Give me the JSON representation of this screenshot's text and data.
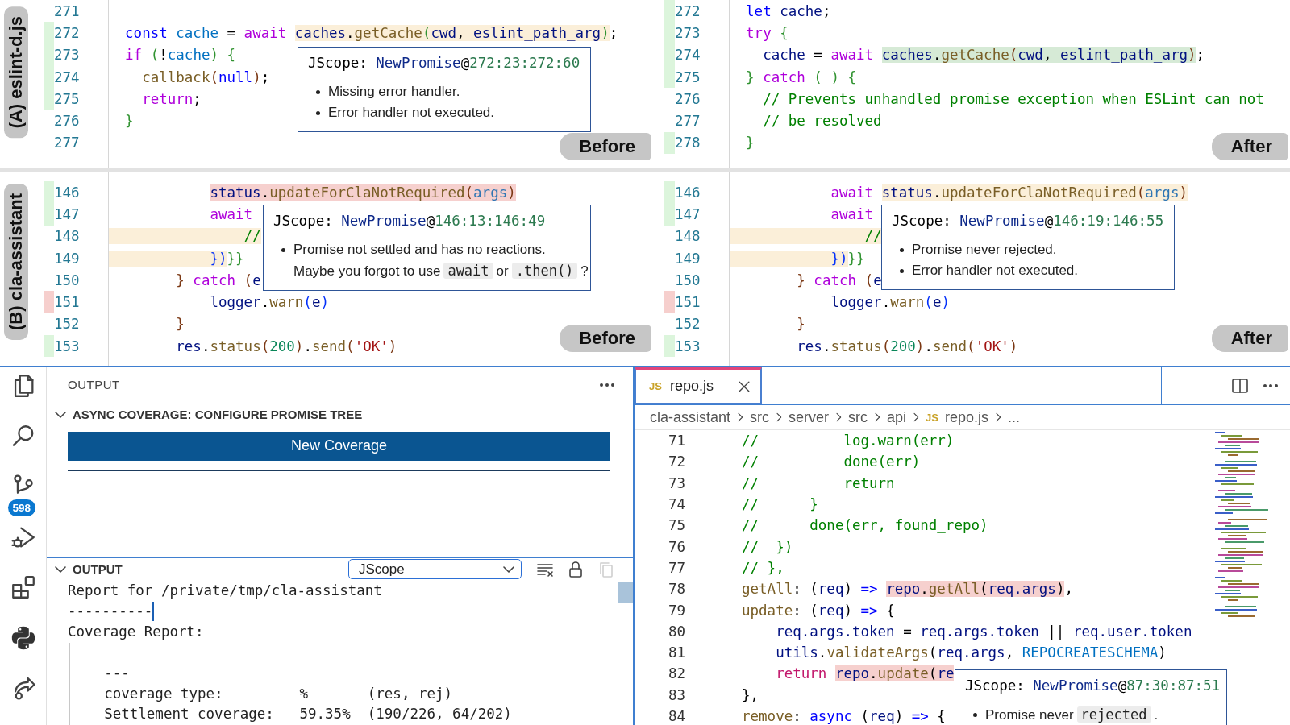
{
  "comparisons": [
    {
      "label": "(A) eslint-d.js",
      "sides": [
        {
          "badge": "Before",
          "lines": [
            {
              "number": "271",
              "added": false,
              "removed": false
            },
            {
              "number": "272",
              "added": true,
              "removed": false,
              "tokens": [
                {
                  "text": "  const ",
                  "kind": "st"
                },
                {
                  "text": "cache",
                  "kind": "c"
                },
                {
                  "text": " = ",
                  "kind": "p"
                },
                {
                  "text": "await ",
                  "kind": "ctl"
                },
                {
                  "text": "caches",
                  "kind": "v",
                  "color": "#fbefd9"
                },
                {
                  "text": ".",
                  "kind": "p",
                  "color": "#fbefd9"
                },
                {
                  "text": "getCache",
                  "kind": "fn",
                  "color": "#fbefd9"
                },
                {
                  "text": "(",
                  "kind": "b2",
                  "color": "#fbefd9"
                },
                {
                  "text": "cwd",
                  "kind": "v",
                  "color": "#fbefd9"
                },
                {
                  "text": ", ",
                  "kind": "p",
                  "color": "#fbefd9"
                },
                {
                  "text": "eslint_path_arg",
                  "kind": "v",
                  "color": "#fbefd9"
                },
                {
                  "text": ")",
                  "kind": "b2",
                  "color": "#fbefd9"
                },
                {
                  "text": ";",
                  "kind": "p"
                }
              ]
            },
            {
              "number": "273",
              "added": true,
              "removed": false,
              "tokens": [
                {
                  "text": "  if ",
                  "kind": "ctl"
                },
                {
                  "text": "(",
                  "kind": "b2"
                },
                {
                  "text": "!",
                  "kind": "p"
                },
                {
                  "text": "cache",
                  "kind": "c"
                },
                {
                  "text": ")",
                  "kind": "b2"
                },
                {
                  "text": " {",
                  "kind": "b2"
                }
              ]
            },
            {
              "number": "274",
              "added": true,
              "removed": false,
              "tokens": [
                {
                  "text": "    callback",
                  "kind": "fn"
                },
                {
                  "text": "(",
                  "kind": "b3"
                },
                {
                  "text": "null",
                  "kind": "st"
                },
                {
                  "text": ")",
                  "kind": "b3"
                },
                {
                  "text": ";",
                  "kind": "p"
                }
              ]
            },
            {
              "number": "275",
              "added": true,
              "removed": false,
              "tokens": [
                {
                  "text": "    return",
                  "kind": "ctl"
                },
                {
                  "text": ";",
                  "kind": "p"
                }
              ]
            },
            {
              "number": "276",
              "added": false,
              "removed": false,
              "tokens": [
                {
                  "text": "  }",
                  "kind": "b2"
                }
              ]
            },
            {
              "number": "277",
              "added": false,
              "removed": false
            }
          ],
          "tooltip": {
            "title": [
              {
                "text": "JScope: ",
                "kind": "p"
              },
              {
                "text": "NewPromise",
                "kind": "type"
              },
              {
                "text": "@",
                "kind": "p"
              },
              {
                "text": "272:23:272:60",
                "kind": "loc"
              }
            ],
            "items": [
              {
                "bulleted": true,
                "segments": [
                  {
                    "text": "Missing error handler.",
                    "kind": "plain"
                  }
                ]
              },
              {
                "bulleted": true,
                "segments": [
                  {
                    "text": "Error handler not executed.",
                    "kind": "plain"
                  }
                ]
              }
            ]
          }
        },
        {
          "badge": "After",
          "lines": [
            {
              "number": "272",
              "added": true,
              "removed": false,
              "tokens": [
                {
                  "text": "  let",
                  "kind": "st"
                },
                {
                  "text": " cache",
                  "kind": "v"
                },
                {
                  "text": ";",
                  "kind": "p"
                }
              ]
            },
            {
              "number": "273",
              "added": true,
              "removed": false,
              "tokens": [
                {
                  "text": "  try",
                  "kind": "ctl"
                },
                {
                  "text": " {",
                  "kind": "b2"
                }
              ]
            },
            {
              "number": "274",
              "added": true,
              "removed": false,
              "tokens": [
                {
                  "text": "    cache",
                  "kind": "v"
                },
                {
                  "text": " = ",
                  "kind": "p"
                },
                {
                  "text": "await ",
                  "kind": "ctl"
                },
                {
                  "text": "caches",
                  "kind": "v",
                  "color": "#d6ead6"
                },
                {
                  "text": ".",
                  "kind": "p",
                  "color": "#d6ead6"
                },
                {
                  "text": "getCache",
                  "kind": "fn",
                  "color": "#d6ead6"
                },
                {
                  "text": "(",
                  "kind": "b3",
                  "color": "#d6ead6"
                },
                {
                  "text": "cwd",
                  "kind": "v",
                  "color": "#d6ead6"
                },
                {
                  "text": ", ",
                  "kind": "p",
                  "color": "#d6ead6"
                },
                {
                  "text": "eslint_path_arg",
                  "kind": "v",
                  "color": "#d6ead6"
                },
                {
                  "text": ")",
                  "kind": "b3",
                  "color": "#d6ead6"
                },
                {
                  "text": ";",
                  "kind": "p"
                }
              ]
            },
            {
              "number": "275",
              "added": true,
              "removed": false,
              "tokens": [
                {
                  "text": "  }",
                  "kind": "b2"
                },
                {
                  "text": " catch",
                  "kind": "ctl"
                },
                {
                  "text": " (",
                  "kind": "b2"
                },
                {
                  "text": "_",
                  "kind": "v"
                },
                {
                  "text": ")",
                  "kind": "b2"
                },
                {
                  "text": " {",
                  "kind": "b2"
                }
              ]
            },
            {
              "number": "276",
              "added": false,
              "removed": false,
              "tokens": [
                {
                  "text": "    // Prevents unhandled promise exception when ESLint can not",
                  "kind": "com"
                }
              ]
            },
            {
              "number": "277",
              "added": false,
              "removed": false,
              "tokens": [
                {
                  "text": "    // be resolved",
                  "kind": "com"
                }
              ]
            },
            {
              "number": "278",
              "added": true,
              "removed": false,
              "tokens": [
                {
                  "text": "  }",
                  "kind": "b2"
                }
              ]
            }
          ]
        }
      ]
    },
    {
      "label": "(B) cla-assistant",
      "sides": [
        {
          "badge": "Before",
          "lines": [
            {
              "number": "146",
              "added": true,
              "removed": false,
              "band": false,
              "tokens": [
                {
                  "text": "            status",
                  "kind": "v",
                  "color": "#f6d0ce"
                },
                {
                  "text": ".",
                  "kind": "p",
                  "color": "#f6d0ce"
                },
                {
                  "text": "updateForClaNotRequired",
                  "kind": "fn",
                  "color": "#f6d0ce"
                },
                {
                  "text": "(",
                  "kind": "b3",
                  "color": "#f6d0ce"
                },
                {
                  "text": "args",
                  "kind": "prm",
                  "color": "#f6d0ce"
                },
                {
                  "text": ")",
                  "kind": "b3",
                  "color": "#f6d0ce"
                }
              ]
            },
            {
              "number": "147",
              "added": true,
              "removed": false,
              "band": false,
              "tokens": [
                {
                  "text": "            await",
                  "kind": "ctl"
                }
              ]
            },
            {
              "number": "148",
              "added": false,
              "removed": false,
              "band": true,
              "tokens": [
                {
                  "text": "                //",
                  "kind": "com",
                  "color": "#fbefd9"
                }
              ]
            },
            {
              "number": "149",
              "added": false,
              "removed": false,
              "band": true,
              "tokens": [
                {
                  "text": "            })",
                  "kind": "b1",
                  "color": "#fbefd9"
                },
                {
                  "text": "}}",
                  "kind": "b2"
                }
              ]
            },
            {
              "number": "150",
              "added": false,
              "removed": false,
              "band": false,
              "tokens": [
                {
                  "text": "        }",
                  "kind": "b3"
                },
                {
                  "text": " catch",
                  "kind": "ctl"
                },
                {
                  "text": " (",
                  "kind": "b3"
                },
                {
                  "text": "e",
                  "kind": "v"
                }
              ]
            },
            {
              "number": "151",
              "added": false,
              "removed": true,
              "band": false,
              "tokens": [
                {
                  "text": "            logger",
                  "kind": "v"
                },
                {
                  "text": ".",
                  "kind": "p"
                },
                {
                  "text": "warn",
                  "kind": "fn"
                },
                {
                  "text": "(",
                  "kind": "b1"
                },
                {
                  "text": "e",
                  "kind": "v"
                },
                {
                  "text": ")",
                  "kind": "b1"
                }
              ]
            },
            {
              "number": "152",
              "added": false,
              "removed": false,
              "band": false,
              "tokens": [
                {
                  "text": "        }",
                  "kind": "b3"
                }
              ]
            },
            {
              "number": "153",
              "added": true,
              "removed": false,
              "band": false,
              "tokens": [
                {
                  "text": "        res",
                  "kind": "v"
                },
                {
                  "text": ".",
                  "kind": "p"
                },
                {
                  "text": "status",
                  "kind": "fn"
                },
                {
                  "text": "(",
                  "kind": "b3"
                },
                {
                  "text": "200",
                  "kind": "num"
                },
                {
                  "text": ")",
                  "kind": "b3"
                },
                {
                  "text": ".",
                  "kind": "p"
                },
                {
                  "text": "send",
                  "kind": "fn"
                },
                {
                  "text": "(",
                  "kind": "b3"
                },
                {
                  "text": "'OK'",
                  "kind": "str"
                },
                {
                  "text": ")",
                  "kind": "b3"
                }
              ]
            }
          ],
          "tooltip": {
            "title": [
              {
                "text": "JScope: ",
                "kind": "p"
              },
              {
                "text": "NewPromise",
                "kind": "type"
              },
              {
                "text": "@",
                "kind": "p"
              },
              {
                "text": "146:13:146:49",
                "kind": "loc"
              }
            ],
            "items": [
              {
                "bulleted": true,
                "segments": [
                  {
                    "text": "Promise not settled and has no reactions.",
                    "kind": "plain"
                  }
                ]
              },
              {
                "bulleted": false,
                "segments": [
                  {
                    "text": "Maybe you forgot to use",
                    "kind": "plain"
                  },
                  {
                    "text": "await",
                    "kind": "code"
                  },
                  {
                    "text": "or",
                    "kind": "plain"
                  },
                  {
                    "text": ".then()",
                    "kind": "code"
                  },
                  {
                    "text": "?",
                    "kind": "plain"
                  }
                ]
              }
            ]
          }
        },
        {
          "badge": "After",
          "lines": [
            {
              "number": "146",
              "added": true,
              "removed": false,
              "band": false,
              "tokens": [
                {
                  "text": "            await ",
                  "kind": "ctl"
                },
                {
                  "text": "status",
                  "kind": "v",
                  "color": "#fbefd9"
                },
                {
                  "text": ".",
                  "kind": "p",
                  "color": "#fbefd9"
                },
                {
                  "text": "updateForClaNotRequired",
                  "kind": "fn",
                  "color": "#fbefd9"
                },
                {
                  "text": "(",
                  "kind": "b3",
                  "color": "#fbefd9"
                },
                {
                  "text": "args",
                  "kind": "prm",
                  "color": "#fbefd9"
                },
                {
                  "text": ")",
                  "kind": "b3",
                  "color": "#fbefd9"
                }
              ]
            },
            {
              "number": "147",
              "added": true,
              "removed": false,
              "band": false,
              "tokens": [
                {
                  "text": "            await",
                  "kind": "ctl"
                }
              ]
            },
            {
              "number": "148",
              "added": false,
              "removed": false,
              "band": true,
              "tokens": [
                {
                  "text": "                //",
                  "kind": "com",
                  "color": "#fbefd9"
                }
              ]
            },
            {
              "number": "149",
              "added": false,
              "removed": false,
              "band": true,
              "tokens": [
                {
                  "text": "            })",
                  "kind": "b1",
                  "color": "#fbefd9"
                },
                {
                  "text": "}}",
                  "kind": "b2"
                }
              ]
            },
            {
              "number": "150",
              "added": false,
              "removed": false,
              "band": false,
              "tokens": [
                {
                  "text": "        }",
                  "kind": "b3"
                },
                {
                  "text": " catch",
                  "kind": "ctl"
                },
                {
                  "text": " (",
                  "kind": "b3"
                },
                {
                  "text": "e",
                  "kind": "v"
                }
              ]
            },
            {
              "number": "151",
              "added": false,
              "removed": true,
              "band": false,
              "tokens": [
                {
                  "text": "            logger",
                  "kind": "v"
                },
                {
                  "text": ".",
                  "kind": "p"
                },
                {
                  "text": "warn",
                  "kind": "fn"
                },
                {
                  "text": "(",
                  "kind": "b1"
                },
                {
                  "text": "e",
                  "kind": "v"
                },
                {
                  "text": ")",
                  "kind": "b1"
                }
              ]
            },
            {
              "number": "152",
              "added": false,
              "removed": false,
              "band": false,
              "tokens": [
                {
                  "text": "        }",
                  "kind": "b3"
                }
              ]
            },
            {
              "number": "153",
              "added": true,
              "removed": false,
              "band": false,
              "tokens": [
                {
                  "text": "        res",
                  "kind": "v"
                },
                {
                  "text": ".",
                  "kind": "p"
                },
                {
                  "text": "status",
                  "kind": "fn"
                },
                {
                  "text": "(",
                  "kind": "b3"
                },
                {
                  "text": "200",
                  "kind": "num"
                },
                {
                  "text": ")",
                  "kind": "b3"
                },
                {
                  "text": ".",
                  "kind": "p"
                },
                {
                  "text": "send",
                  "kind": "fn"
                },
                {
                  "text": "(",
                  "kind": "b3"
                },
                {
                  "text": "'OK'",
                  "kind": "str"
                },
                {
                  "text": ")",
                  "kind": "b3"
                }
              ]
            }
          ],
          "tooltip": {
            "title": [
              {
                "text": "JScope: ",
                "kind": "p"
              },
              {
                "text": "NewPromise",
                "kind": "type"
              },
              {
                "text": "@",
                "kind": "p"
              },
              {
                "text": "146:19:146:55",
                "kind": "loc"
              }
            ],
            "items": [
              {
                "bulleted": true,
                "segments": [
                  {
                    "text": "Promise never rejected.",
                    "kind": "plain"
                  }
                ]
              },
              {
                "bulleted": true,
                "segments": [
                  {
                    "text": "Error handler not executed.",
                    "kind": "plain"
                  }
                ]
              }
            ]
          }
        }
      ]
    }
  ],
  "activity_bar": {
    "items": [
      {
        "kind": "files"
      },
      {
        "kind": "search"
      },
      {
        "kind": "source-control",
        "badge": "598"
      },
      {
        "kind": "run-debug"
      },
      {
        "kind": "extensions"
      },
      {
        "kind": "python"
      },
      {
        "kind": "remote"
      }
    ]
  },
  "side_panel": {
    "title": "OUTPUT",
    "sections": [
      {
        "kind": "actions",
        "title": "ASYNC COVERAGE: CONFIGURE PROMISE TREE",
        "expanded": true,
        "button": "New Coverage"
      },
      {
        "kind": "output",
        "title": "OUTPUT",
        "expanded": true,
        "dropdown": "JScope",
        "tools": [
          {
            "kind": "clear",
            "disabled": false
          },
          {
            "kind": "lock",
            "disabled": false
          },
          {
            "kind": "copy",
            "disabled": true
          }
        ],
        "lines": [
          {
            "text": "Report for /private/tmp/cla-assistant",
            "cursor": false
          },
          {
            "text": "----------",
            "cursor": true
          },
          {
            "text": "Coverage Report:",
            "cursor": false
          }
        ],
        "block": [
          "    ---",
          "    coverage type:         %       (res, rej)",
          "    Settlement coverage:   59.35%  (190/226, 64/202)"
        ]
      }
    ]
  },
  "editor": {
    "tabs": [
      {
        "label": "repo.js",
        "icon": "JS",
        "selected": true
      }
    ],
    "breadcrumb": [
      {
        "text": "cla-assistant"
      },
      {
        "text": "src"
      },
      {
        "text": "server"
      },
      {
        "text": "src"
      },
      {
        "text": "api"
      },
      {
        "text": "repo.js",
        "icon": "JS"
      },
      {
        "text": "..."
      }
    ],
    "lines": [
      {
        "number": "71",
        "tokens": [
          {
            "text": "//          log.warn(err)",
            "kind": "com"
          }
        ]
      },
      {
        "number": "72",
        "tokens": [
          {
            "text": "//          done(err)",
            "kind": "com"
          }
        ]
      },
      {
        "number": "73",
        "tokens": [
          {
            "text": "//          return",
            "kind": "com"
          }
        ]
      },
      {
        "number": "74",
        "tokens": [
          {
            "text": "//      }",
            "kind": "com"
          }
        ]
      },
      {
        "number": "75",
        "tokens": [
          {
            "text": "//      done(err, found_repo)",
            "kind": "com"
          }
        ]
      },
      {
        "number": "76",
        "tokens": [
          {
            "text": "//  })",
            "kind": "com"
          }
        ]
      },
      {
        "number": "77",
        "tokens": [
          {
            "text": "// },",
            "kind": "com"
          }
        ]
      },
      {
        "number": "78",
        "tokens": [
          {
            "text": "getAll",
            "kind": "fn"
          },
          {
            "text": ": (",
            "kind": "p"
          },
          {
            "text": "req",
            "kind": "v"
          },
          {
            "text": ") ",
            "kind": "p"
          },
          {
            "text": "=> ",
            "kind": "st"
          },
          {
            "text": "repo",
            "kind": "v",
            "color": "#f6d0ce"
          },
          {
            "text": ".",
            "kind": "p",
            "color": "#f6d0ce"
          },
          {
            "text": "getAll",
            "kind": "fn",
            "color": "#f6d0ce"
          },
          {
            "text": "(",
            "kind": "p",
            "color": "#f6d0ce"
          },
          {
            "text": "req.args",
            "kind": "v",
            "color": "#f6d0ce"
          },
          {
            "text": ")",
            "kind": "p",
            "color": "#f6d0ce"
          },
          {
            "text": ",",
            "kind": "p"
          }
        ]
      },
      {
        "number": "79",
        "tokens": [
          {
            "text": "update",
            "kind": "fn"
          },
          {
            "text": ": (",
            "kind": "p"
          },
          {
            "text": "req",
            "kind": "v"
          },
          {
            "text": ") ",
            "kind": "p"
          },
          {
            "text": "=>",
            "kind": "st"
          },
          {
            "text": " {",
            "kind": "p"
          }
        ]
      },
      {
        "number": "80",
        "tokens": [
          {
            "text": "    req.args.token",
            "kind": "v"
          },
          {
            "text": " = ",
            "kind": "p"
          },
          {
            "text": "req.args.token",
            "kind": "v"
          },
          {
            "text": " || ",
            "kind": "p"
          },
          {
            "text": "req.user.token",
            "kind": "v"
          }
        ]
      },
      {
        "number": "81",
        "tokens": [
          {
            "text": "    utils",
            "kind": "v"
          },
          {
            "text": ".",
            "kind": "p"
          },
          {
            "text": "validateArgs",
            "kind": "fn"
          },
          {
            "text": "(",
            "kind": "p"
          },
          {
            "text": "req.args",
            "kind": "v"
          },
          {
            "text": ", ",
            "kind": "p"
          },
          {
            "text": "REPOCREATESCHEMA",
            "kind": "c"
          },
          {
            "text": ")",
            "kind": "p"
          }
        ]
      },
      {
        "number": "82",
        "tokens": [
          {
            "text": "    return ",
            "kind": "ret"
          },
          {
            "text": "repo",
            "kind": "v",
            "color": "#f6d0ce"
          },
          {
            "text": ".",
            "kind": "p",
            "color": "#f6d0ce"
          },
          {
            "text": "update",
            "kind": "fn",
            "color": "#f6d0ce"
          },
          {
            "text": "(",
            "kind": "p",
            "color": "#f6d0ce"
          },
          {
            "text": "re",
            "kind": "v",
            "color": "#f6d0ce"
          }
        ]
      },
      {
        "number": "83",
        "tokens": [
          {
            "text": "},",
            "kind": "p"
          }
        ]
      },
      {
        "number": "84",
        "tokens": [
          {
            "text": "remove",
            "kind": "fn"
          },
          {
            "text": ": ",
            "kind": "p"
          },
          {
            "text": "async",
            "kind": "st"
          },
          {
            "text": " (",
            "kind": "p"
          },
          {
            "text": "req",
            "kind": "v"
          },
          {
            "text": ") ",
            "kind": "p"
          },
          {
            "text": "=>",
            "kind": "st"
          },
          {
            "text": " {",
            "kind": "p"
          }
        ]
      }
    ],
    "tooltip": {
      "title": [
        {
          "text": "JScope: ",
          "kind": "p"
        },
        {
          "text": "NewPromise",
          "kind": "type"
        },
        {
          "text": "@",
          "kind": "p"
        },
        {
          "text": "87:30:87:51",
          "kind": "loc"
        }
      ],
      "items": [
        {
          "bulleted": true,
          "segments": [
            {
              "text": "Promise never",
              "kind": "plain"
            },
            {
              "text": "rejected",
              "kind": "code"
            },
            {
              "text": ".",
              "kind": "plain"
            }
          ]
        }
      ]
    }
  }
}
